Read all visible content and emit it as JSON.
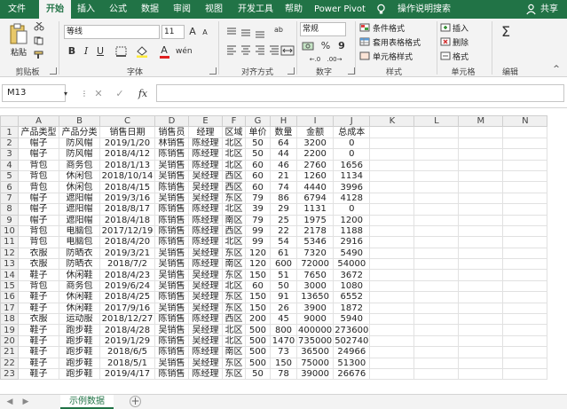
{
  "tabs": [
    "文件",
    "开始",
    "插入",
    "公式",
    "数据",
    "审阅",
    "视图",
    "开发工具",
    "帮助",
    "Power Pivot",
    "操作说明搜索",
    "共享"
  ],
  "ribbon": {
    "paste_label": "粘贴",
    "clipboard_label": "剪贴板",
    "font_name": "等线",
    "font_size": "11",
    "font_group_label": "字体",
    "align_group_label": "对齐方式",
    "number_format": "常规",
    "number_group_label": "数字",
    "cond_format": "条件格式",
    "table_format": "套用表格格式",
    "cell_style": "单元格样式",
    "style_group_label": "样式",
    "insert": "插入",
    "delete": "删除",
    "format": "格式",
    "cells_group_label": "单元格",
    "edit_group_label": "编辑",
    "bold": "B",
    "italic": "I",
    "underline": "U",
    "font_grow": "A",
    "font_shrink": "A",
    "font_color": "A",
    "percent": "%",
    "comma": "9",
    "align_wrap": "ab",
    "editing_icon": "Σ"
  },
  "formula_bar": {
    "name_box": "M13",
    "fx": "fx",
    "cancel": "✕",
    "enter": "✓"
  },
  "columns": [
    "A",
    "B",
    "C",
    "D",
    "E",
    "F",
    "G",
    "H",
    "I",
    "J",
    "K",
    "L",
    "M",
    "N"
  ],
  "rows": [
    [
      "产品类型",
      "产品分类",
      "销售日期",
      "销售员",
      "经理",
      "区域",
      "单价",
      "数量",
      "金额",
      "总成本",
      "",
      "",
      "",
      ""
    ],
    [
      "帽子",
      "防风帽",
      "2019/1/20",
      "林销售",
      "陈经理",
      "北区",
      "50",
      "64",
      "3200",
      "0",
      "",
      "",
      "",
      ""
    ],
    [
      "帽子",
      "防风帽",
      "2018/4/12",
      "陈销售",
      "陈经理",
      "北区",
      "50",
      "44",
      "2200",
      "0",
      "",
      "",
      "",
      ""
    ],
    [
      "背包",
      "商务包",
      "2018/1/13",
      "吴销售",
      "陈经理",
      "北区",
      "60",
      "46",
      "2760",
      "1656",
      "",
      "",
      "",
      ""
    ],
    [
      "背包",
      "休闲包",
      "2018/10/14",
      "吴销售",
      "吴经理",
      "西区",
      "60",
      "21",
      "1260",
      "1134",
      "",
      "",
      "",
      ""
    ],
    [
      "背包",
      "休闲包",
      "2018/4/15",
      "陈销售",
      "吴经理",
      "西区",
      "60",
      "74",
      "4440",
      "3996",
      "",
      "",
      "",
      ""
    ],
    [
      "帽子",
      "遮阳帽",
      "2019/3/16",
      "吴销售",
      "吴经理",
      "东区",
      "79",
      "86",
      "6794",
      "4128",
      "",
      "",
      "",
      ""
    ],
    [
      "帽子",
      "遮阳帽",
      "2018/8/17",
      "陈销售",
      "陈经理",
      "北区",
      "39",
      "29",
      "1131",
      "0",
      "",
      "",
      "",
      ""
    ],
    [
      "帽子",
      "遮阳帽",
      "2018/4/18",
      "陈销售",
      "陈经理",
      "南区",
      "79",
      "25",
      "1975",
      "1200",
      "",
      "",
      "",
      ""
    ],
    [
      "背包",
      "电脑包",
      "2017/12/19",
      "陈销售",
      "陈经理",
      "西区",
      "99",
      "22",
      "2178",
      "1188",
      "",
      "",
      "",
      ""
    ],
    [
      "背包",
      "电脑包",
      "2018/4/20",
      "陈销售",
      "陈经理",
      "北区",
      "99",
      "54",
      "5346",
      "2916",
      "",
      "",
      "",
      ""
    ],
    [
      "衣服",
      "防晒衣",
      "2019/3/21",
      "吴销售",
      "吴经理",
      "东区",
      "120",
      "61",
      "7320",
      "5490",
      "",
      "",
      "",
      ""
    ],
    [
      "衣服",
      "防晒衣",
      "2018/7/2",
      "吴销售",
      "陈经理",
      "南区",
      "120",
      "600",
      "72000",
      "54000",
      "",
      "",
      "",
      ""
    ],
    [
      "鞋子",
      "休闲鞋",
      "2018/4/23",
      "吴销售",
      "吴经理",
      "东区",
      "150",
      "51",
      "7650",
      "3672",
      "",
      "",
      "",
      ""
    ],
    [
      "背包",
      "商务包",
      "2019/6/24",
      "吴销售",
      "吴经理",
      "北区",
      "60",
      "50",
      "3000",
      "1080",
      "",
      "",
      "",
      ""
    ],
    [
      "鞋子",
      "休闲鞋",
      "2018/4/25",
      "陈销售",
      "吴经理",
      "东区",
      "150",
      "91",
      "13650",
      "6552",
      "",
      "",
      "",
      ""
    ],
    [
      "鞋子",
      "休闲鞋",
      "2017/9/16",
      "吴销售",
      "吴经理",
      "东区",
      "150",
      "26",
      "3900",
      "1872",
      "",
      "",
      "",
      ""
    ],
    [
      "衣服",
      "运动服",
      "2018/12/27",
      "陈销售",
      "陈经理",
      "西区",
      "200",
      "45",
      "9000",
      "5940",
      "",
      "",
      "",
      ""
    ],
    [
      "鞋子",
      "跑步鞋",
      "2018/4/28",
      "吴销售",
      "吴经理",
      "北区",
      "500",
      "800",
      "400000",
      "273600",
      "",
      "",
      "",
      ""
    ],
    [
      "鞋子",
      "跑步鞋",
      "2019/1/29",
      "陈销售",
      "吴经理",
      "北区",
      "500",
      "1470",
      "735000",
      "502740",
      "",
      "",
      "",
      ""
    ],
    [
      "鞋子",
      "跑步鞋",
      "2018/6/5",
      "陈销售",
      "陈经理",
      "南区",
      "500",
      "73",
      "36500",
      "24966",
      "",
      "",
      "",
      ""
    ],
    [
      "鞋子",
      "跑步鞋",
      "2018/5/1",
      "吴销售",
      "吴经理",
      "东区",
      "500",
      "150",
      "75000",
      "51300",
      "",
      "",
      "",
      ""
    ],
    [
      "鞋子",
      "跑步鞋",
      "2019/4/17",
      "陈销售",
      "陈经理",
      "东区",
      "50",
      "78",
      "39000",
      "26676",
      "",
      "",
      "",
      ""
    ]
  ],
  "sheet_tab": "示例数据",
  "add_sheet": "+",
  "colors": {
    "accent": "#217346",
    "ribbon_bg": "#f3f3f3",
    "grid_line": "#e1e1e1"
  }
}
